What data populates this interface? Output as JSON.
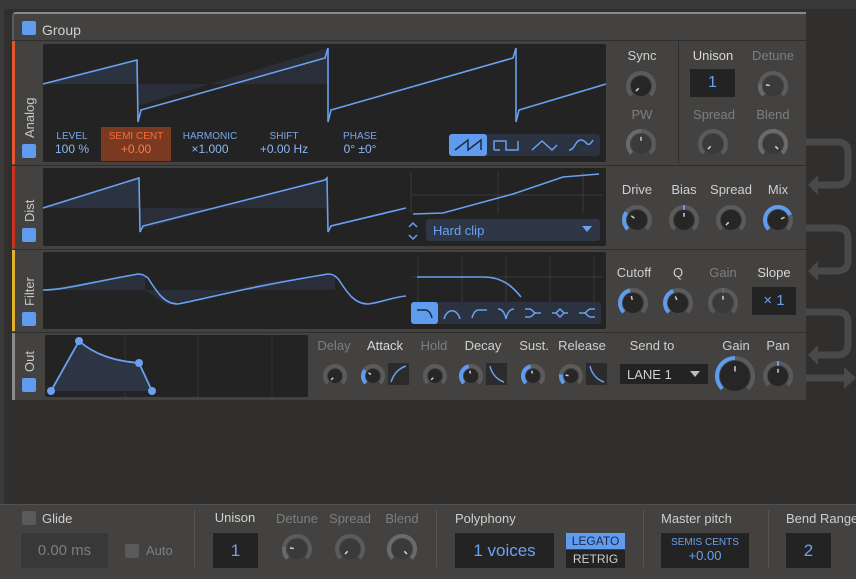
{
  "group": {
    "title": "Group",
    "enabled": true
  },
  "lanes": {
    "analog": {
      "label": "Analog",
      "color": "#e0562e",
      "params": [
        {
          "label": "LEVEL",
          "value": "100 %"
        },
        {
          "label": "SEMI CENT",
          "value": "+0.00",
          "selected": true
        },
        {
          "label": "HARMONIC",
          "value": "×1.000"
        },
        {
          "label": "SHIFT",
          "value": "+0.00 Hz"
        },
        {
          "label": "PHASE",
          "value": "0° ±0°"
        }
      ],
      "waveforms": [
        "saw",
        "square",
        "triangle",
        "sine"
      ],
      "selected_waveform": "saw",
      "sync_label": "Sync",
      "pw_label": "PW",
      "unison_label": "Unison",
      "unison_value": "1",
      "detune_label": "Detune",
      "spread_label": "Spread",
      "blend_label": "Blend"
    },
    "dist": {
      "label": "Dist",
      "color": "#c8341f",
      "mode": "Hard clip",
      "knobs": [
        {
          "label": "Drive",
          "value": 0.3
        },
        {
          "label": "Bias",
          "value": 0.5
        },
        {
          "label": "Spread",
          "value": 0.0
        },
        {
          "label": "Mix",
          "value": 0.75
        }
      ]
    },
    "filter": {
      "label": "Filter",
      "color": "#e0b22a",
      "types": [
        "lowpass",
        "bandpass",
        "highpass",
        "notch",
        "lowshelf",
        "peak",
        "highshelf"
      ],
      "selected_type": "lowpass",
      "knobs": [
        {
          "label": "Cutoff",
          "value": 0.45
        },
        {
          "label": "Q",
          "value": 0.42
        },
        {
          "label": "Gain",
          "value": 0.5,
          "disabled": true
        }
      ],
      "slope_label": "Slope",
      "slope_value": "× 1"
    },
    "out": {
      "label": "Out",
      "color": "#8a8a8a",
      "env": [
        {
          "label": "Delay",
          "dim": true
        },
        {
          "label": "Attack"
        },
        {
          "label": "Hold",
          "dim": true
        },
        {
          "label": "Decay"
        },
        {
          "label": "Sust."
        },
        {
          "label": "Release"
        }
      ],
      "send_to_label": "Send to",
      "send_to_value": "LANE 1",
      "gain_label": "Gain",
      "pan_label": "Pan"
    }
  },
  "bottom": {
    "glide_label": "Glide",
    "glide_value": "0.00 ms",
    "auto_label": "Auto",
    "unison_label": "Unison",
    "unison_value": "1",
    "detune_label": "Detune",
    "spread_label": "Spread",
    "blend_label": "Blend",
    "polyphony_label": "Polyphony",
    "polyphony_value": "1 voices",
    "legato_label": "LEGATO",
    "retrig_label": "RETRIG",
    "master_pitch_label": "Master pitch",
    "master_pitch_sub": "SEMIS CENTS",
    "master_pitch_value": "+0.00",
    "bend_range_label": "Bend Range",
    "bend_range_value": "2"
  },
  "colors": {
    "accent": "#5f9cf0",
    "selected_param_bg": "#7a3a22",
    "selected_param_text": "#ff6a3a"
  }
}
